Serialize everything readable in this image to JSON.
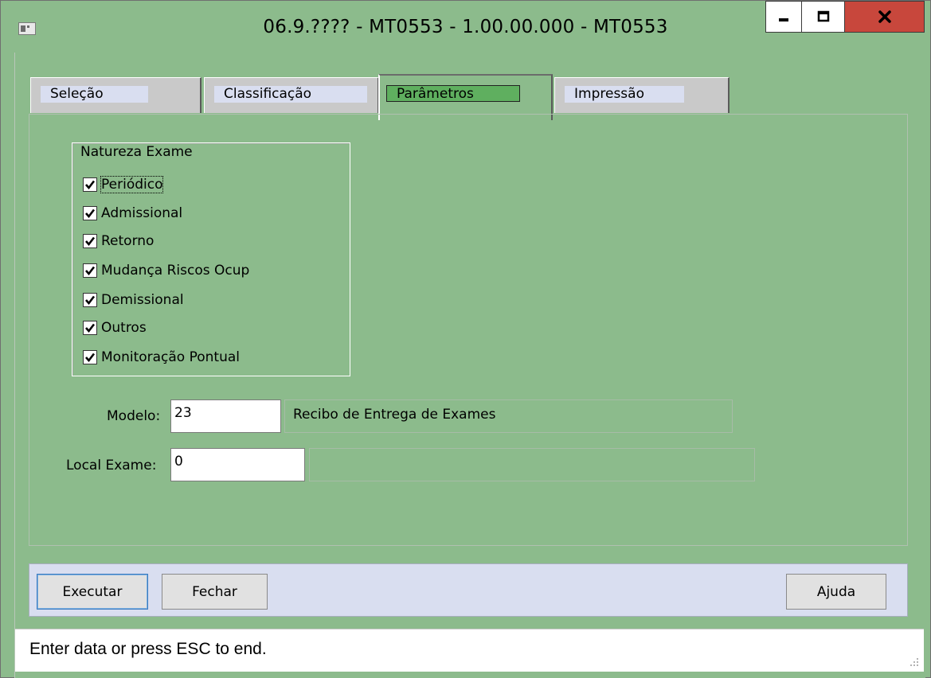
{
  "window": {
    "title": "06.9.???? - MT0553 - 1.00.00.000 - MT0553",
    "controls": {
      "minimize_icon": "minimize-icon",
      "maximize_icon": "maximize-icon",
      "close_icon": "close-icon"
    }
  },
  "tabs": [
    {
      "label": "Seleção",
      "active": false
    },
    {
      "label": "Classificação",
      "active": false
    },
    {
      "label": "Parâmetros",
      "active": true
    },
    {
      "label": "Impressão",
      "active": false
    }
  ],
  "natureza": {
    "legend": "Natureza Exame",
    "items": [
      {
        "label": "Periódico",
        "checked": true
      },
      {
        "label": "Admissional",
        "checked": true
      },
      {
        "label": "Retorno",
        "checked": true
      },
      {
        "label": "Mudança Riscos Ocup",
        "checked": true
      },
      {
        "label": "Demissional",
        "checked": true
      },
      {
        "label": "Outros",
        "checked": true
      },
      {
        "label": "Monitoração Pontual",
        "checked": true
      }
    ]
  },
  "modelo": {
    "label": "Modelo:",
    "value": "23",
    "description": "Recibo de Entrega de Exames"
  },
  "local_exame": {
    "label": "Local Exame:",
    "value": "0",
    "description": ""
  },
  "buttons": {
    "executar": "Executar",
    "fechar": "Fechar",
    "ajuda": "Ajuda"
  },
  "status": {
    "text": "Enter data or press ESC to end."
  },
  "colors": {
    "background": "#8cbb8c",
    "close_button": "#c8473c",
    "active_tab_label": "#5faf5f",
    "button_bar": "#d9def0"
  }
}
